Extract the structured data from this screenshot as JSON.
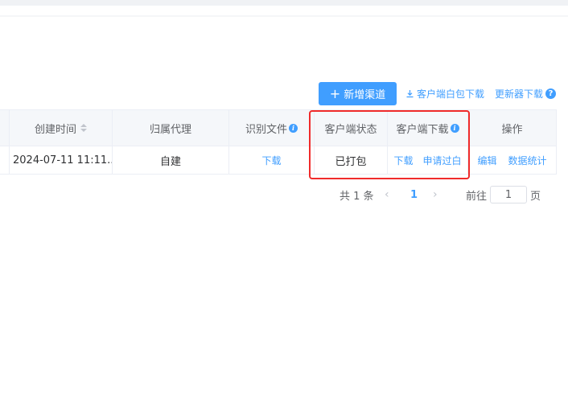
{
  "toolbar": {
    "add_channel_label": "新增渠道",
    "client_package_download_label": "客户端白包下载",
    "updater_download_label": "更新器下载"
  },
  "table": {
    "columns": [
      "创建时间",
      "归属代理",
      "识别文件",
      "客户端状态",
      "客户端下载",
      "操作"
    ],
    "rows": [
      {
        "created_time": "2024-07-11 11:11...",
        "agent": "自建",
        "id_file": "下载",
        "client_status": "已打包",
        "client_download": "下载",
        "client_whitelist": "申请过白",
        "edit": "编辑",
        "stats": "数据统计"
      }
    ]
  },
  "pagination": {
    "total": "共 1 条",
    "current_page": "1",
    "goto_label": "前往",
    "goto_value": "1",
    "page_suffix": "页"
  },
  "colors": {
    "primary": "#409eff",
    "highlight": "#f02b2b"
  }
}
